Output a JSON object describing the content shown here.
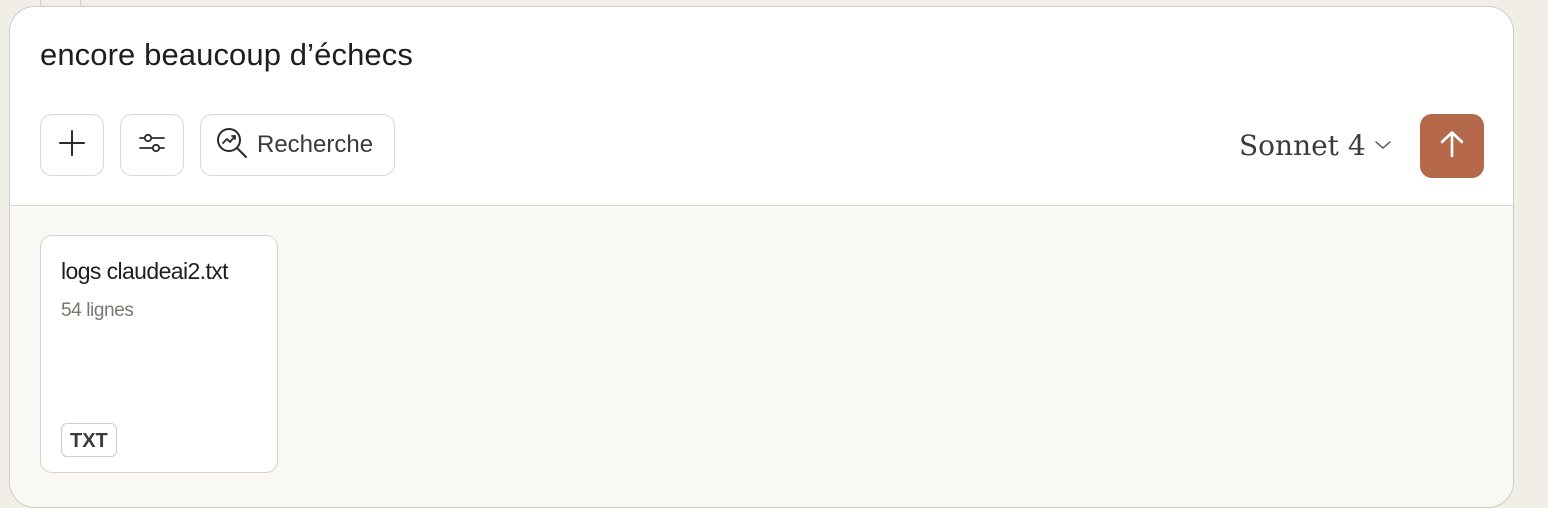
{
  "composer": {
    "prompt_text": "encore beaucoup d’échecs",
    "research_label": "Recherche",
    "model_label": "Sonnet 4",
    "send_color": "#b5684a"
  },
  "icons": {
    "add": "plus-icon",
    "tools": "sliders-icon",
    "research": "search-trend-icon",
    "model": "chevron-down-icon",
    "send": "arrow-up-icon"
  },
  "attachments": [
    {
      "name": "logs claudeai2.txt",
      "lines": "54 lignes",
      "type": "TXT"
    }
  ]
}
